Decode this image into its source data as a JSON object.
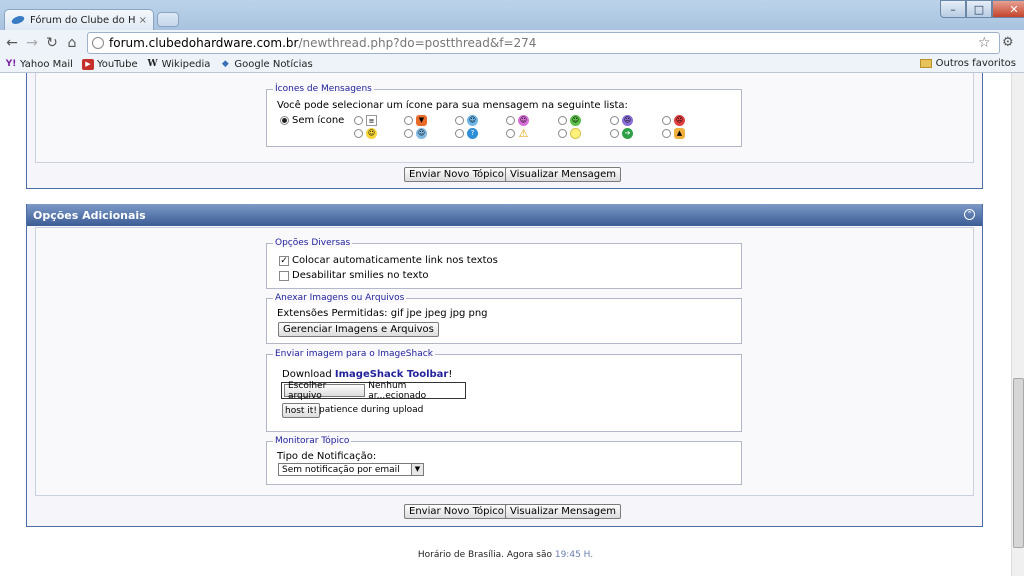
{
  "browser": {
    "tab_title": "Fórum do Clube do Hardw...",
    "tab_close": "×",
    "url_host": "forum.clubedohardware.com.br",
    "url_path": "/newthread.php?do=postthread&f=274",
    "bookmarks": [
      {
        "icon": "yahoo-icon",
        "label": "Yahoo Mail"
      },
      {
        "icon": "youtube-icon",
        "label": "YouTube"
      },
      {
        "icon": "wikipedia-icon",
        "label": "Wikipedia"
      },
      {
        "icon": "google-news-icon",
        "label": "Google Notícias"
      }
    ],
    "other_bookmarks": "Outros favoritos",
    "colors": {
      "chrome": "#bcd3ea",
      "close": "#c2432b"
    }
  },
  "icons_section": {
    "legend": "Ícones de Mensagens",
    "instruction": "Você pode selecionar um ícone para sua mensagem na seguinte lista:",
    "no_icon_label": "Sem ícone"
  },
  "top_buttons": {
    "submit": "Enviar Novo Tópico",
    "preview": "Visualizar Mensagem"
  },
  "additional": {
    "title": "Opções Adicionais",
    "misc": {
      "legend": "Opções Diversas",
      "auto_link": "Colocar automaticamente link nos textos",
      "disable_smilies": "Desabilitar smilies no texto"
    },
    "attach": {
      "legend": "Anexar Imagens ou Arquivos",
      "extensions": "Extensões Permitidas: gif jpe jpeg jpg png",
      "manage": "Gerenciar Imagens e Arquivos"
    },
    "imageshack": {
      "legend": "Enviar imagem para o ImageShack",
      "download_prefix": "Download ",
      "toolbar_link": "ImageShack Toolbar",
      "download_suffix": "!",
      "choose_file": "Escolher arquivo",
      "no_file": "Nenhum ar...ecionado",
      "host_it": "host it!",
      "patience": "patience during upload"
    },
    "monitor": {
      "legend": "Monitorar Tópico",
      "label": "Tipo de Notificação:",
      "selected": "Sem notificação por email"
    }
  },
  "bottom_buttons": {
    "submit": "Enviar Novo Tópico",
    "preview": "Visualizar Mensagem"
  },
  "footer": {
    "prefix": "Horário de Brasília. Agora são ",
    "time": "19:45",
    "suffix": " H."
  }
}
